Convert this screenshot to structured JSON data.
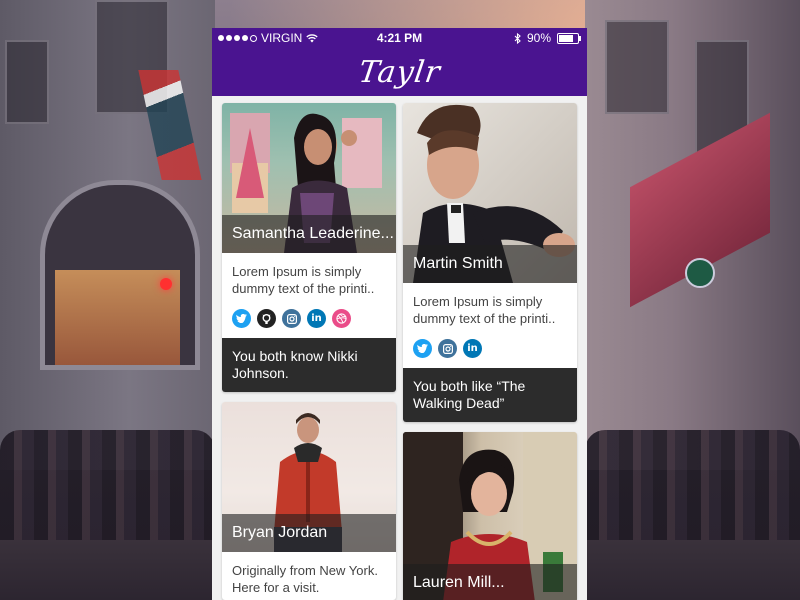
{
  "status_bar": {
    "carrier": "VIRGIN",
    "time": "4:21 PM",
    "battery_percent": "90%",
    "battery_level": 0.9,
    "icons": [
      "signal-dots-icon",
      "wifi-icon",
      "bluetooth-icon",
      "battery-icon"
    ]
  },
  "app": {
    "title": "Taylr",
    "accent_color": "#4a1490"
  },
  "profiles": [
    {
      "name": "Samantha Leaderine...",
      "description": "Lorem Ipsum is simply dummy text of the printi..",
      "socials": [
        "twitter-icon",
        "github-icon",
        "instagram-icon",
        "linkedin-icon",
        "dribbble-icon"
      ],
      "mutual": "You both know Nikki Johnson."
    },
    {
      "name": "Martin Smith",
      "description": "Lorem Ipsum is simply dummy text of the printi..",
      "socials": [
        "twitter-icon",
        "instagram-icon",
        "linkedin-icon"
      ],
      "mutual": "You both like “The Walking Dead”"
    },
    {
      "name": "Bryan Jordan",
      "description": "Originally from New York. Here for a visit."
    },
    {
      "name": "Lauren Mill..."
    }
  ],
  "social_colors": {
    "twitter": "#1da1f2",
    "github": "#222222",
    "instagram": "#3f729b",
    "linkedin": "#0077b5",
    "dribbble": "#ea4c89"
  }
}
